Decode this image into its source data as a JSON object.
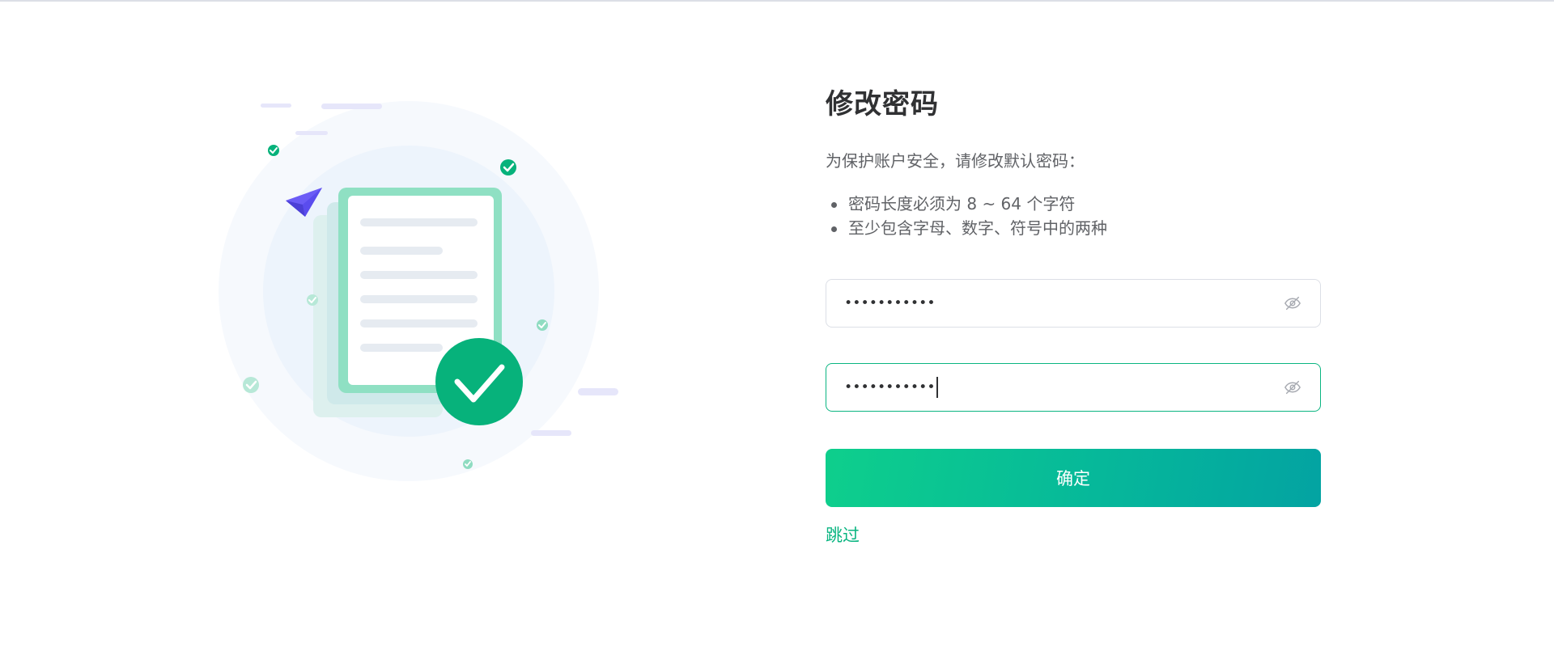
{
  "form": {
    "title": "修改密码",
    "description": "为保护账户安全，请修改默认密码：",
    "rules": [
      "密码长度必须为 8 ~ 64 个字符",
      "至少包含字母、数字、符号中的两种"
    ],
    "new_password_value": "•••••••••••",
    "confirm_password_value": "•••••••••••",
    "submit_label": "确定",
    "skip_label": "跳过",
    "eye_icon": "eye-hidden-icon"
  },
  "colors": {
    "accent": "#0ab581",
    "gradient_start": "#0ecf8c",
    "gradient_end": "#03a3a2",
    "paper_plane": "#6b5cf6"
  }
}
